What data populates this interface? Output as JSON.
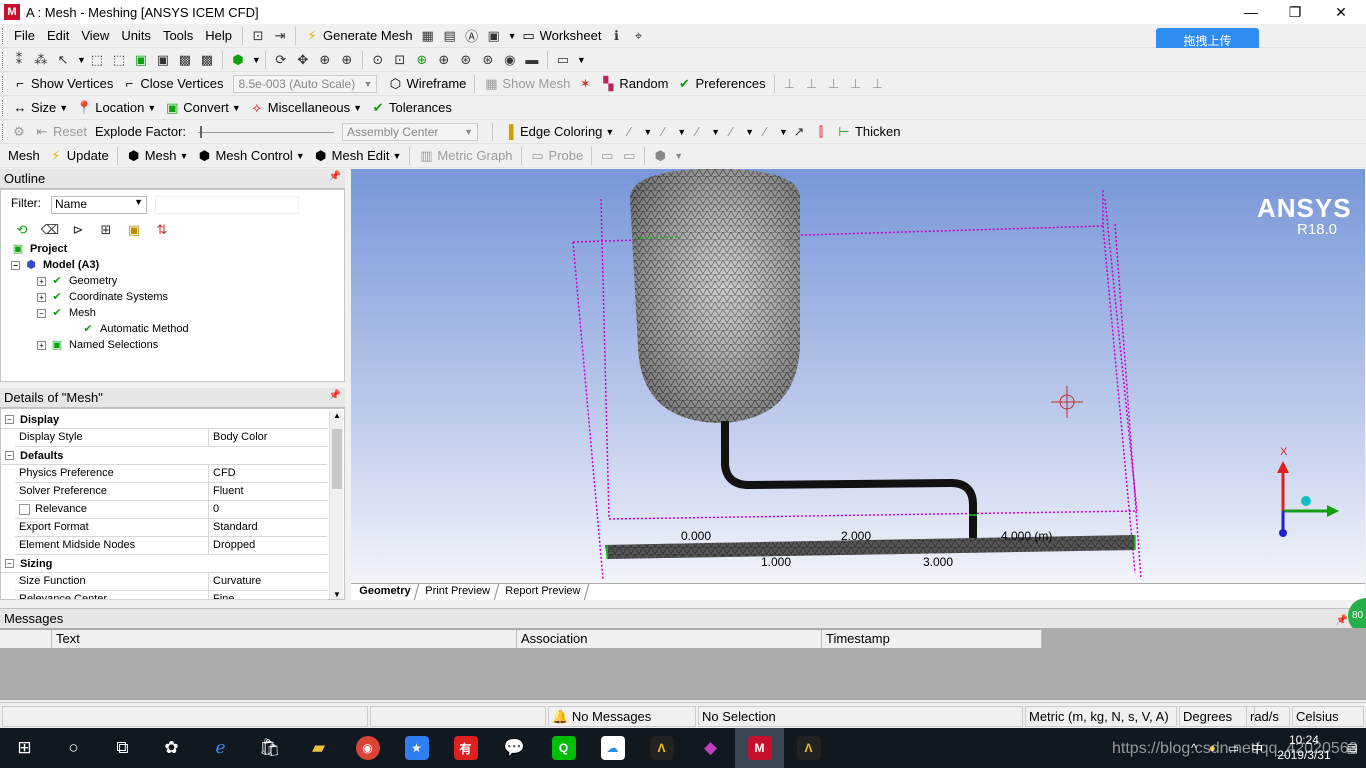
{
  "window": {
    "title": "A : Mesh - Meshing [ANSYS ICEM CFD]",
    "logo": "M",
    "minimize": "—",
    "maximize": "❐",
    "close": "✕"
  },
  "menu": [
    "File",
    "Edit",
    "View",
    "Units",
    "Tools",
    "Help"
  ],
  "main_toolbar": {
    "generate_mesh": "Generate Mesh",
    "worksheet": "Worksheet"
  },
  "upload_button": "拖拽上传",
  "graphics_toolbar": {
    "show_vertices": "Show Vertices",
    "close_vertices": "Close Vertices",
    "scale_value": "8.5e-003 (Auto Scale)",
    "wireframe": "Wireframe",
    "show_mesh": "Show Mesh",
    "random": "Random",
    "preferences": "Preferences"
  },
  "context_toolbar": {
    "size": "Size",
    "location": "Location",
    "convert": "Convert",
    "miscellaneous": "Miscellaneous",
    "tolerances": "Tolerances"
  },
  "explode_toolbar": {
    "reset": "Reset",
    "explode_factor": "Explode Factor:",
    "assembly_center": "Assembly Center",
    "edge_coloring": "Edge Coloring",
    "thicken": "Thicken"
  },
  "mesh_toolbar": {
    "mesh_label": "Mesh",
    "update": "Update",
    "mesh": "Mesh",
    "mesh_control": "Mesh Control",
    "mesh_edit": "Mesh Edit",
    "metric_graph": "Metric Graph",
    "probe": "Probe"
  },
  "outline": {
    "title": "Outline",
    "filter_label": "Filter:",
    "filter_value": "Name",
    "tree": [
      {
        "label": "Project",
        "bold": true
      },
      {
        "label": "Model (A3)",
        "bold": true
      },
      {
        "label": "Geometry"
      },
      {
        "label": "Coordinate Systems"
      },
      {
        "label": "Mesh"
      },
      {
        "label": "Automatic Method"
      },
      {
        "label": "Named Selections"
      }
    ]
  },
  "details": {
    "title": "Details of \"Mesh\"",
    "rows": [
      {
        "type": "section",
        "label": "Display"
      },
      {
        "type": "row",
        "k": "Display Style",
        "v": "Body Color"
      },
      {
        "type": "section",
        "label": "Defaults"
      },
      {
        "type": "row",
        "k": "Physics Preference",
        "v": "CFD"
      },
      {
        "type": "row",
        "k": "Solver Preference",
        "v": "Fluent"
      },
      {
        "type": "row",
        "k": "Relevance",
        "v": "0",
        "checkbox": true
      },
      {
        "type": "row",
        "k": "Export Format",
        "v": "Standard"
      },
      {
        "type": "row",
        "k": "Element Midside Nodes",
        "v": "Dropped"
      },
      {
        "type": "section",
        "label": "Sizing"
      },
      {
        "type": "row",
        "k": "Size Function",
        "v": "Curvature"
      },
      {
        "type": "row",
        "k": "Relevance Center",
        "v": "Fine"
      }
    ]
  },
  "viewport": {
    "brand": "ANSYS",
    "version": "R18.0",
    "scale_top": [
      "0.000",
      "2.000",
      "4.000 (m)"
    ],
    "scale_bottom": [
      "1.000",
      "3.000"
    ],
    "axis_x": "X"
  },
  "view_tabs": [
    "Geometry",
    "Print Preview",
    "Report Preview"
  ],
  "messages": {
    "title": "Messages",
    "columns": [
      "Text",
      "Association",
      "Timestamp"
    ],
    "badge": "80"
  },
  "status": {
    "messages": "No Messages",
    "selection": "No Selection",
    "units": "Metric (m, kg, N, s, V, A)",
    "angle": "Degrees",
    "ang_vel": "rad/s",
    "temp": "Celsius"
  },
  "taskbar": {
    "time": "10:24",
    "date": "2019/3/31",
    "ime": "中",
    "watermark": "https://blog.csdn.net/qq_42020563"
  }
}
